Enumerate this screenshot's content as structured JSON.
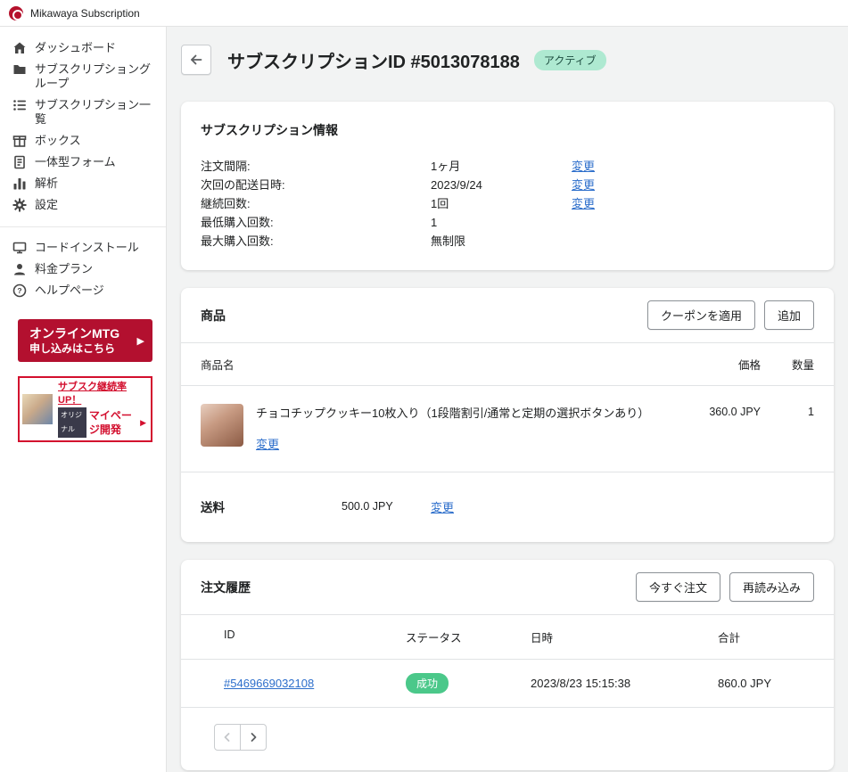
{
  "topbar": {
    "brand": "Mikawaya Subscription"
  },
  "sidebar": {
    "items": [
      {
        "label": "ダッシュボード",
        "icon": "home-icon"
      },
      {
        "label": "サブスクリプショングループ",
        "icon": "folder-icon"
      },
      {
        "label": "サブスクリプション一覧",
        "icon": "list-icon"
      },
      {
        "label": "ボックス",
        "icon": "box-icon"
      },
      {
        "label": "一体型フォーム",
        "icon": "form-icon"
      },
      {
        "label": "解析",
        "icon": "chart-icon"
      },
      {
        "label": "設定",
        "icon": "gear-icon"
      }
    ],
    "secondary_items": [
      {
        "label": "コードインストール",
        "icon": "code-icon"
      },
      {
        "label": "料金プラン",
        "icon": "user-icon"
      },
      {
        "label": "ヘルプページ",
        "icon": "help-icon"
      }
    ],
    "mtg_banner": {
      "line1": "オンラインMTG",
      "line2": "申し込みはこちら",
      "arrow": "▶"
    },
    "promo_banner": {
      "line1": "サブスク継続率UP！",
      "tag": "オリジナル",
      "line2": "マイページ開発",
      "arrow": "▶"
    }
  },
  "header": {
    "title": "サブスクリプションID #5013078188",
    "status_badge": "アクティブ"
  },
  "subscription_info": {
    "title": "サブスクリプション情報",
    "rows": [
      {
        "label": "注文間隔:",
        "value": "1ヶ月",
        "action": "変更"
      },
      {
        "label": "次回の配送日時:",
        "value": "2023/9/24",
        "action": "変更"
      },
      {
        "label": "継続回数:",
        "value": "1回",
        "action": "変更"
      },
      {
        "label": "最低購入回数:",
        "value": "1",
        "action": ""
      },
      {
        "label": "最大購入回数:",
        "value": "無制限",
        "action": ""
      }
    ]
  },
  "products": {
    "title": "商品",
    "coupon_button": "クーポンを適用",
    "add_button": "追加",
    "columns": {
      "name": "商品名",
      "price": "価格",
      "qty": "数量"
    },
    "items": [
      {
        "name": "チョコチップクッキー10枚入り（1段階割引/通常と定期の選択ボタンあり）",
        "change_link": "変更",
        "price": "360.0 JPY",
        "qty": "1"
      }
    ],
    "shipping": {
      "label": "送料",
      "price": "500.0 JPY",
      "action": "変更"
    }
  },
  "order_history": {
    "title": "注文履歴",
    "order_now_button": "今すぐ注文",
    "reload_button": "再読み込み",
    "columns": [
      "ID",
      "ステータス",
      "日時",
      "合計"
    ],
    "rows": [
      {
        "id": "#5469669032108",
        "status": "成功",
        "datetime": "2023/8/23 15:15:38",
        "total": "860.0 JPY"
      }
    ]
  }
}
